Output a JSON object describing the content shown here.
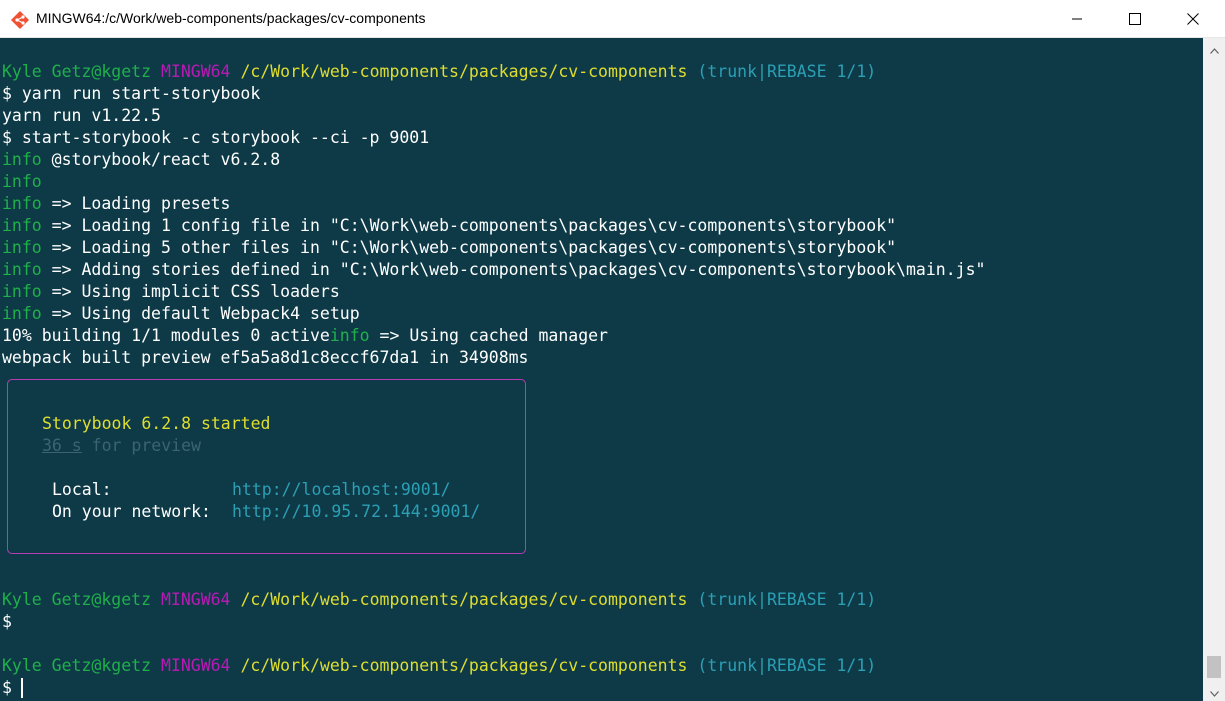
{
  "window": {
    "title": "MINGW64:/c/Work/web-components/packages/cv-components"
  },
  "icons": {
    "app": "git-bash-icon",
    "minimize": "minimize-icon",
    "maximize": "maximize-icon",
    "close": "close-icon",
    "scroll_up": "scroll-up-arrow-icon",
    "scroll_down": "scroll-down-arrow-icon"
  },
  "colors": {
    "terminal_bg": "#0e3a48",
    "prompt_user": "#1fb04a",
    "prompt_host": "#b71bb4",
    "prompt_path": "#dede2e",
    "prompt_branch": "#2b9fb4",
    "box_border": "#b73bb4"
  },
  "prompt": {
    "user": "Kyle Getz@kgetz",
    "env": "MINGW64",
    "path": "/c/Work/web-components/packages/cv-components",
    "branch": "(trunk|REBASE 1/1)",
    "symbol": "$"
  },
  "log": {
    "cmd1": " yarn run start-storybook",
    "yarn_version": "yarn run v1.22.5",
    "cmd2": "$ start-storybook -c storybook --ci -p 9001",
    "info_tag": "info",
    "msg_version": " @storybook/react v6.2.8",
    "msg_presets": " => Loading presets",
    "msg_config": " => Loading 1 config file in \"C:\\Work\\web-components\\packages\\cv-components\\storybook\"",
    "msg_other": " => Loading 5 other files in \"C:\\Work\\web-components\\packages\\cv-components\\storybook\"",
    "msg_stories": " => Adding stories defined in \"C:\\Work\\web-components\\packages\\cv-components\\storybook\\main.js\"",
    "msg_css": " => Using implicit CSS loaders",
    "msg_webpack": " => Using default Webpack4 setup",
    "progress": "10% building 1/1 modules 0 active",
    "msg_cached": " => Using cached manager",
    "built": "webpack built preview ef5a5a8d1c8eccf67da1 in 34908ms"
  },
  "startup_box": {
    "started": "Storybook 6.2.8 started",
    "preview_time": "36 s",
    "preview_suffix": " for preview",
    "local_label": "Local:",
    "local_url": "http://localhost:9001/",
    "network_label": "On your network:",
    "network_url": "http://10.95.72.144:9001/"
  }
}
